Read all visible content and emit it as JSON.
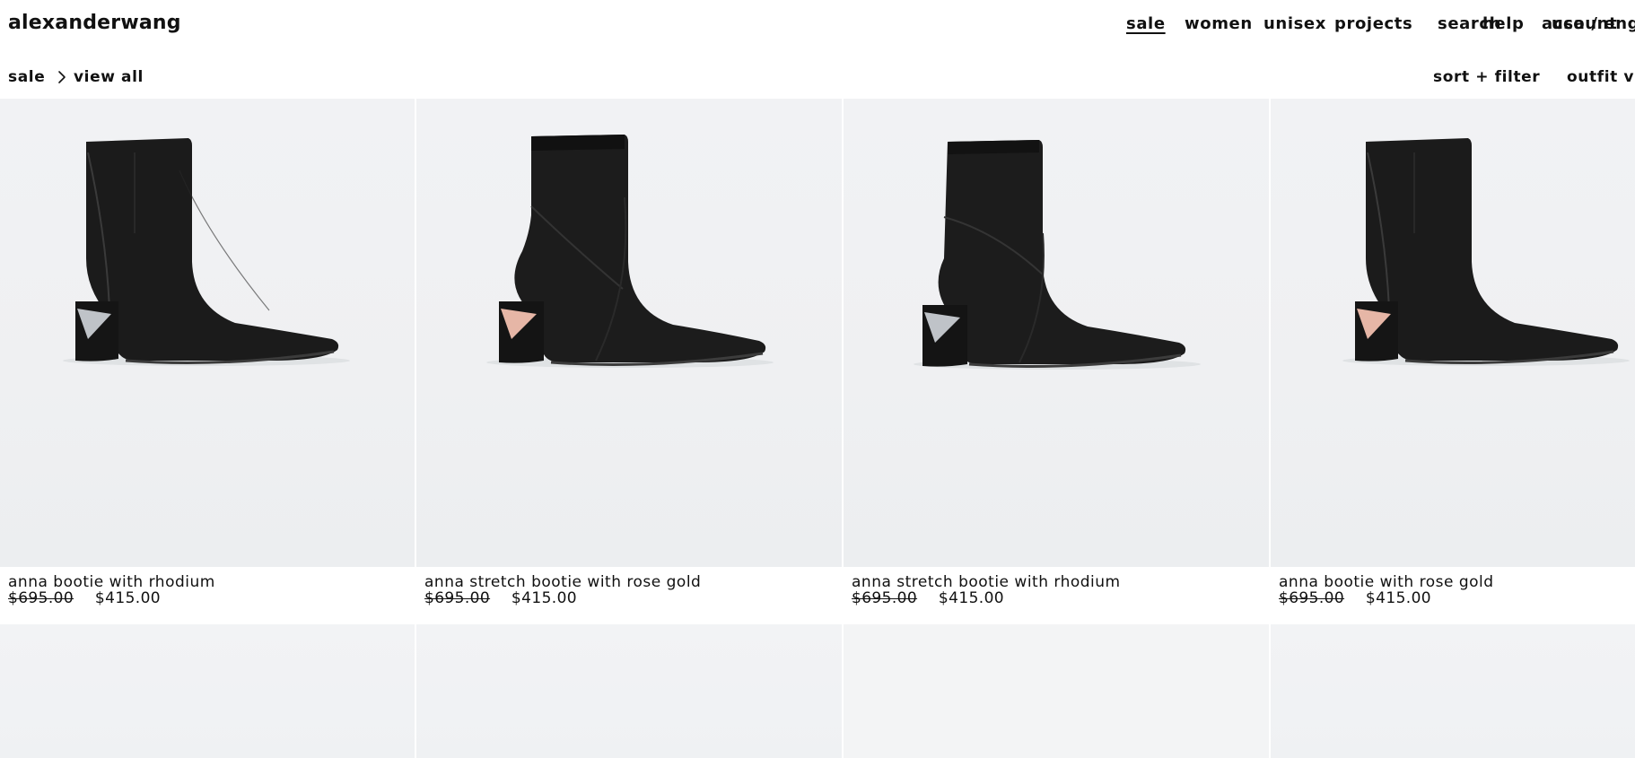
{
  "brand": {
    "logo": "alexanderwang"
  },
  "nav": {
    "items": [
      {
        "label": "sale",
        "active": true
      },
      {
        "label": "women",
        "active": false
      },
      {
        "label": "unisex",
        "active": false
      },
      {
        "label": "projects",
        "active": false
      },
      {
        "label": "search",
        "active": false
      },
      {
        "label": "usa / eng",
        "active": false
      },
      {
        "label": "help",
        "active": false
      },
      {
        "label": "account",
        "active": false
      }
    ]
  },
  "breadcrumb": {
    "root": "sale",
    "separator_icon": "chevron-right-icon",
    "current": "view all"
  },
  "subbar": {
    "sort_filter": "sort + filter",
    "outfit_view": "outfit v"
  },
  "products": [
    {
      "name": "anna bootie with rhodium",
      "old_price": "$695.00",
      "price": "$415.00",
      "heel_accent": "#bfc3c8",
      "boot": "anna"
    },
    {
      "name": "anna stretch bootie with rose gold",
      "old_price": "$695.00",
      "price": "$415.00",
      "heel_accent": "#e6b6a6",
      "boot": "stretch"
    },
    {
      "name": "anna stretch bootie with rhodium",
      "old_price": "$695.00",
      "price": "$415.00",
      "heel_accent": "#bfc3c8",
      "boot": "stretch"
    },
    {
      "name": "anna bootie with rose gold",
      "old_price": "$695.00",
      "price": "$415.00",
      "heel_accent": "#e6b6a6",
      "boot": "anna"
    }
  ],
  "colors": {
    "text": "#111111",
    "background": "#ffffff",
    "image_bg": "#eff0f2",
    "boot": "#1a1a1a"
  }
}
